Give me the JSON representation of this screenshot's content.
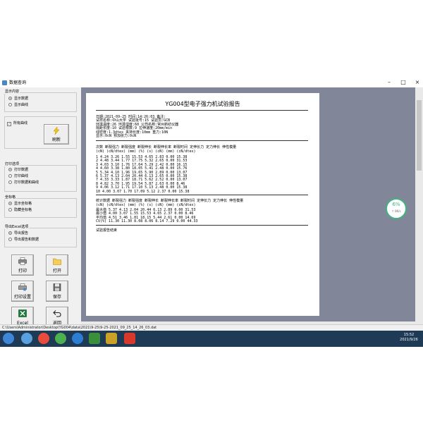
{
  "window": {
    "title": "数据查询"
  },
  "left_panel": {
    "display_group": {
      "title": "显示内容",
      "options": [
        "显示数据",
        "显示曲线"
      ]
    },
    "curve_group": {
      "checkbox_label": "所有曲线",
      "refresh_label": "刷新"
    },
    "print_group": {
      "title": "打印选项",
      "options": [
        "打印数据",
        "打印曲线",
        "打印数据和曲线"
      ]
    },
    "grid_group": {
      "title": "坐标格",
      "options": [
        "显示坐标格",
        "隐藏坐标格"
      ]
    },
    "excel_group": {
      "title": "导出Excel选项",
      "options": [
        "导出报告",
        "导出报告和数据"
      ]
    },
    "buttons": {
      "print": "打印",
      "open": "打开",
      "print_setup": "打印设置",
      "save": "保存",
      "excel": "Excel",
      "back": "返回"
    }
  },
  "report": {
    "title": "YG004型电子强力机试验报告",
    "info_lines": [
      "日期:2021-09-25           时间:14:26:03              备注:",
      "试样名称:中山大学        试验批号:15                试验员:GCB",
      "环境温度:26              环境湿度:60                公司名称:常州新纺仪器",
      "隔距长度:10              试验根数:9                 拉伸速度:20mm/min",
      "线密度:1.3dtex           夹持长度:10mm              重力:10N",
      "显示:0cN                 预加张力:0cN"
    ],
    "header_line1": "次数      断裂强力    断裂强度     断裂伸长    断裂伸长率   断裂时间    定伸长力    定力伸长    伸性模量",
    "header_line2": "          (cN)        (cN/dtex)    (mm)        (%)          (s)         (cN)        (mm)        (cN/dtex)",
    "rows": [
      "1         4.24        3.26         1.55        15.53        4.65        2.83        0.00        15.38",
      "2         4.48        3.44         1.77        17.75        5.32        2.65        0.00        31.53",
      "3         4.03        3.10         1.76        17.64        5.29        2.42        0.00        16.15",
      "4         4.60        3.38         1.80        18.05        5.41        2.48        0.00        15.76",
      "5         5.34        4.10         1.96        19.65        5.90        2.89        0.00        13.07",
      "6         5.37        4.13         2.04        20.44        6.13        2.65        0.00        15.38",
      "7         4.33        3.33         1.87        18.71        5.62        2.52        0.00        13.07",
      "8         4.82        3.70         1.95        19.54        5.87        2.63        0.00        8.46",
      "9         4.06        3.12         1.71        17.10        5.13        2.48        0.00        15.38",
      "10        4.00        3.07         1.70        17.09        5.12        2.37        0.00        15.38"
    ],
    "stats_header1": "统计数据  断裂强力    断裂强度     断裂伸长    断裂伸长率   断裂时间    定伸长力    定力伸长    伸性模量",
    "stats_header2": "          (cN)        (cN/dtex)    (mm)        (%)          (s)         (cN)        (mm)        (cN/dtex)",
    "stats_rows": [
      "最大值    5.37        4.13         2.04        20.44        6.13        2.89        0.00        31.53",
      "最小值    4.00        3.07         1.55        15.53        4.65        2.37        0.00        8.46",
      "平均值    4.51        3.46         1.81        18.15        5.44        2.61        0.00        14.69",
      "CV(%)     11.30       11.30        8.08        8.06         8.14        7.29        0.00        44.33"
    ],
    "footer": "试验报告结束"
  },
  "progress": {
    "percent": "6%",
    "speed": "↑ 0K/s"
  },
  "statusbar": {
    "path": "C:\\Users\\Administrator\\Desktop\\YG004\\data\\2021\\9-25\\9-25-2021_09_25_14_26_03.dat"
  },
  "taskbar": {
    "time": "15:52",
    "date": "2021/9/26"
  }
}
